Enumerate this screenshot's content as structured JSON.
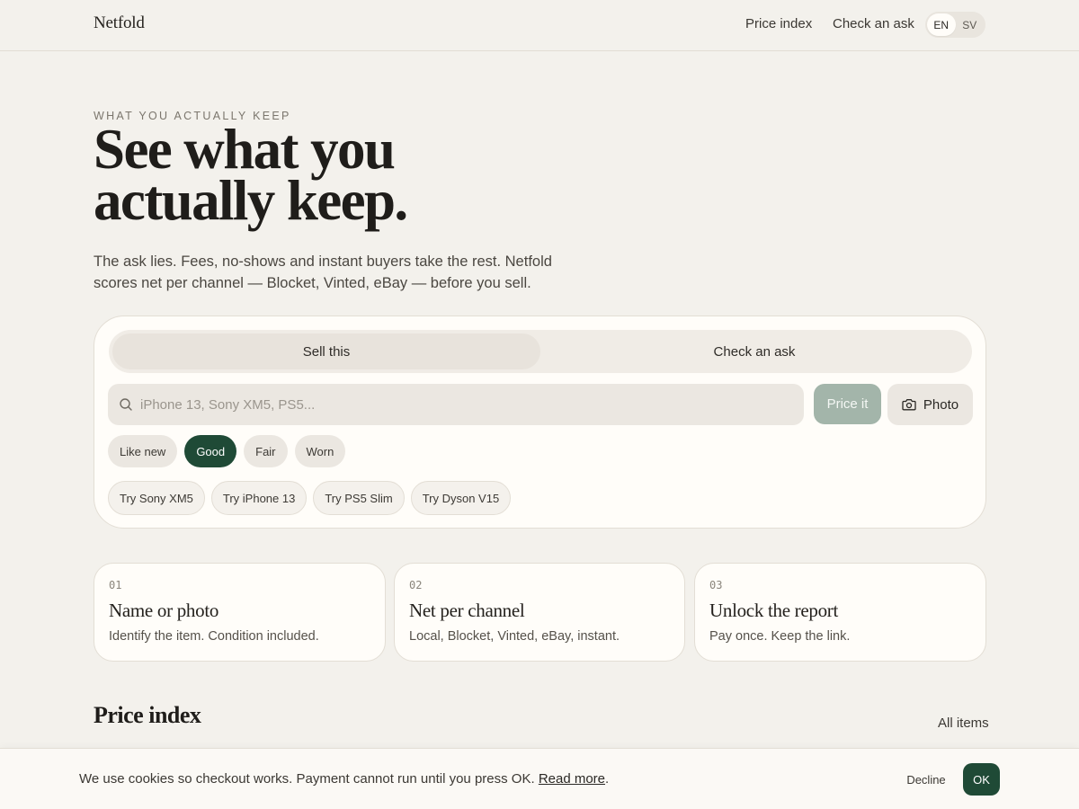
{
  "header": {
    "brand": "Netfold",
    "nav": [
      "Price index",
      "Check an ask"
    ],
    "languages": [
      {
        "code": "EN",
        "active": true
      },
      {
        "code": "SV",
        "active": false
      }
    ]
  },
  "hero": {
    "eyebrow": "WHAT YOU ACTUALLY KEEP",
    "title_line1": "See what you",
    "title_line2": "actually keep.",
    "subtitle": "The ask lies. Fees, no-shows and instant buyers take the rest. Netfold scores net per channel — Blocket, Vinted, eBay — before you sell."
  },
  "search_card": {
    "tabs": [
      {
        "label": "Sell this",
        "active": true
      },
      {
        "label": "Check an ask",
        "active": false
      }
    ],
    "search": {
      "placeholder": "iPhone 13, Sony XM5, PS5...",
      "value": "",
      "icon": "search-icon"
    },
    "price_button": "Price it",
    "photo_button": {
      "label": "Photo",
      "icon": "camera-icon"
    },
    "conditions": [
      {
        "label": "Like new",
        "active": false
      },
      {
        "label": "Good",
        "active": true
      },
      {
        "label": "Fair",
        "active": false
      },
      {
        "label": "Worn",
        "active": false
      }
    ],
    "suggestions": [
      "Try Sony XM5",
      "Try iPhone 13",
      "Try PS5 Slim",
      "Try Dyson V15"
    ]
  },
  "steps": [
    {
      "num": "01",
      "title": "Name or photo",
      "desc": "Identify the item. Condition included."
    },
    {
      "num": "02",
      "title": "Net per channel",
      "desc": "Local, Blocket, Vinted, eBay, instant."
    },
    {
      "num": "03",
      "title": "Unlock the report",
      "desc": "Pay once. Keep the link."
    }
  ],
  "price_index": {
    "title": "Price index",
    "link": "All items"
  },
  "cookie": {
    "text": "We use cookies so checkout works. Payment cannot run until you press OK.",
    "link": "Read more",
    "trailing": ".",
    "decline": "Decline",
    "ok": "OK"
  },
  "colors": {
    "accent": "#1f4a36",
    "background": "#f3f1ec",
    "card": "#fffdf9",
    "disabled_button": "#a3b5aa"
  }
}
